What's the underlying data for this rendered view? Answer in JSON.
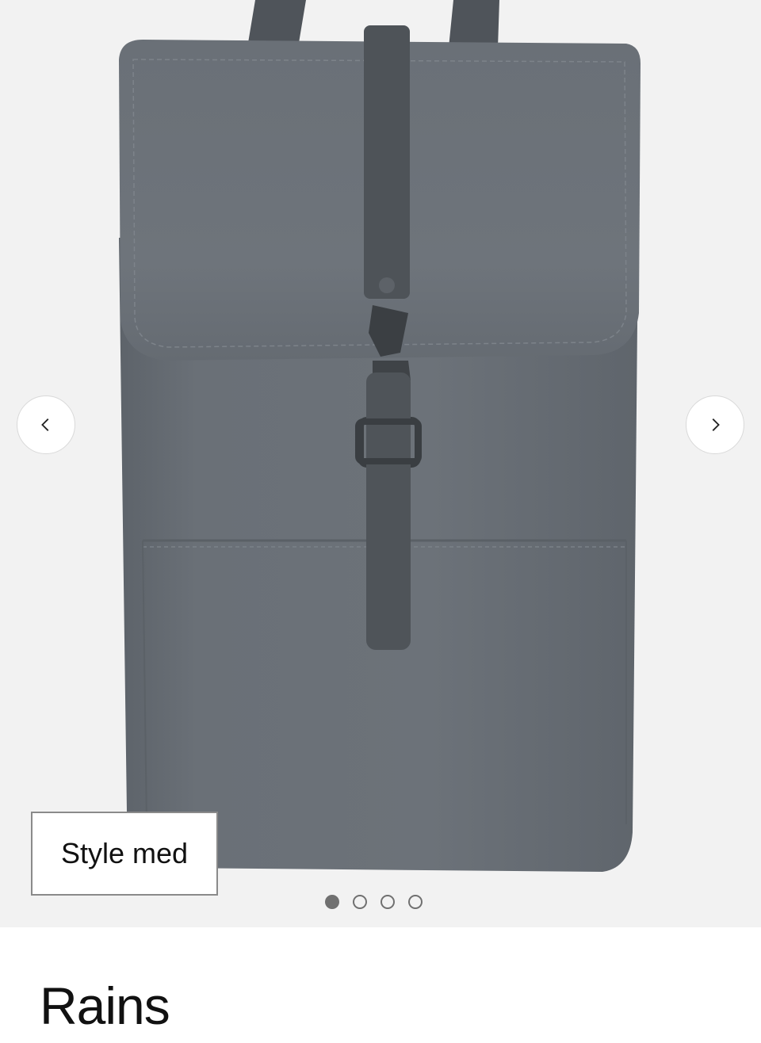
{
  "gallery": {
    "style_badge_label": "Style med",
    "prev_icon": "chevron-left-icon",
    "next_icon": "chevron-right-icon",
    "image_count": 4,
    "active_image_index": 0,
    "product_color": "#666c73"
  },
  "product": {
    "brand": "Rains"
  }
}
